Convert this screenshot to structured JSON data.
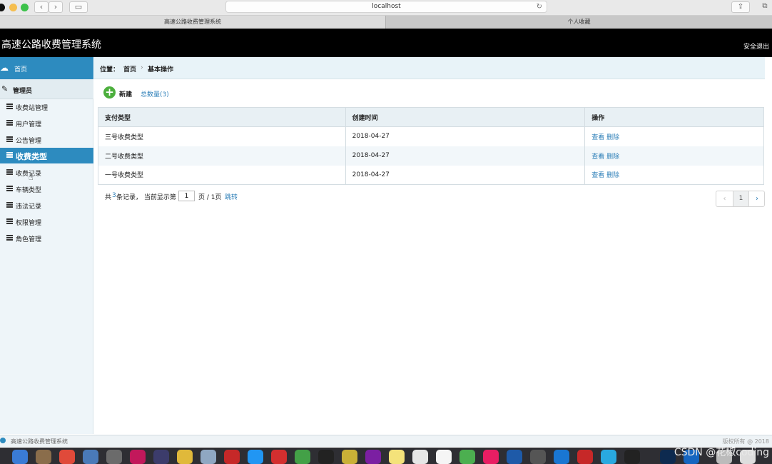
{
  "browser": {
    "url": "localhost",
    "tabs": [
      {
        "label": "高速公路收费管理系统"
      },
      {
        "label": "个人收藏"
      }
    ]
  },
  "header": {
    "title": "高速公路收费管理系统",
    "logout": "安全退出"
  },
  "sidebar": {
    "home": "首页",
    "group": "管理员",
    "items": [
      {
        "label": "收费站管理"
      },
      {
        "label": "用户管理"
      },
      {
        "label": "公告管理"
      },
      {
        "label": "收费类型",
        "active": true
      },
      {
        "label": "收费记录"
      },
      {
        "label": "车辆类型"
      },
      {
        "label": "违法记录"
      },
      {
        "label": "权限管理"
      },
      {
        "label": "角色管理"
      }
    ]
  },
  "breadcrumb": {
    "label": "位置：",
    "home": "首页",
    "separator": "›",
    "current": "基本操作"
  },
  "toolbar": {
    "new_label": "新建",
    "total_label": "总数量(3)"
  },
  "table": {
    "headers": [
      "支付类型",
      "创建时间",
      "操作"
    ],
    "rows": [
      {
        "type": "三号收费类型",
        "created": "2018-04-27",
        "view": "查看",
        "delete": "删除"
      },
      {
        "type": "二号收费类型",
        "created": "2018-04-27",
        "view": "查看",
        "delete": "删除"
      },
      {
        "type": "一号收费类型",
        "created": "2018-04-27",
        "view": "查看",
        "delete": "删除"
      }
    ]
  },
  "pagination": {
    "prefix": "共",
    "count": "3",
    "middle": "条记录，  当前显示第",
    "current_page": "1",
    "suffix": "页 / 1页",
    "go_label": "跳转",
    "page_number": "1",
    "prev_symbol": "‹",
    "next_symbol": "›"
  },
  "footer": {
    "title": "高速公路收费管理系统",
    "copyright": "版权所有 @ 2018"
  },
  "watermark": "CSDN @花椒coding",
  "colors": {
    "accent": "#2d8bbf",
    "link": "#2d7fb8",
    "header_bg": "#000000",
    "add_button": "#4caf3d"
  }
}
